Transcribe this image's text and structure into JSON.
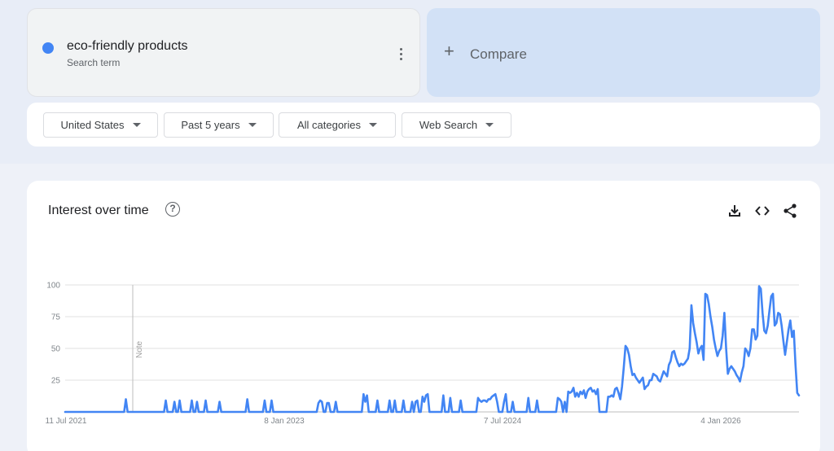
{
  "search_term": {
    "name": "eco-friendly products",
    "type_label": "Search term",
    "color": "#4285f4"
  },
  "compare": {
    "plus": "+",
    "label": "Compare"
  },
  "filters": [
    {
      "label": "United States"
    },
    {
      "label": "Past 5 years"
    },
    {
      "label": "All categories"
    },
    {
      "label": "Web Search"
    }
  ],
  "chart_card": {
    "title": "Interest over time",
    "help_icon": "?",
    "tools": [
      "download-icon",
      "embed-code-icon",
      "share-icon"
    ]
  },
  "chart_data": {
    "type": "line",
    "title": "Interest over time",
    "xlabel": "",
    "ylabel": "",
    "ylim": [
      0,
      100
    ],
    "y_ticks": [
      25,
      50,
      75,
      100
    ],
    "x_tick_labels": [
      "11 Jul 2021",
      "8 Jan 2023",
      "7 Jul 2024",
      "4 Jan 2026"
    ],
    "x_range": [
      "11 Jul 2021",
      "5 Jul 2026"
    ],
    "gridlines": true,
    "annotation": "Note",
    "series": [
      {
        "name": "eco-friendly products",
        "color": "#4285f4",
        "values": [
          0,
          0,
          0,
          0,
          0,
          0,
          0,
          0,
          0,
          0,
          0,
          0,
          0,
          0,
          0,
          0,
          0,
          0,
          0,
          0,
          0,
          0,
          0,
          0,
          0,
          0,
          0,
          0,
          0,
          0,
          0,
          0,
          0,
          0,
          0,
          10,
          0,
          0,
          0,
          0,
          0,
          0,
          0,
          0,
          0,
          0,
          0,
          0,
          0,
          0,
          0,
          0,
          0,
          0,
          0,
          0,
          0,
          0,
          9,
          0,
          0,
          0,
          0,
          8,
          0,
          0,
          9,
          0,
          0,
          0,
          0,
          0,
          0,
          9,
          0,
          0,
          8,
          0,
          0,
          0,
          0,
          9,
          0,
          0,
          0,
          0,
          0,
          0,
          0,
          8,
          0,
          0,
          0,
          0,
          0,
          0,
          0,
          0,
          0,
          0,
          0,
          0,
          0,
          0,
          0,
          10,
          0,
          0,
          0,
          0,
          0,
          0,
          0,
          0,
          0,
          9,
          0,
          0,
          0,
          9,
          0,
          0,
          0,
          0,
          0,
          0,
          0,
          0,
          0,
          0,
          0,
          0,
          0,
          0,
          0,
          0,
          0,
          0,
          0,
          0,
          0,
          0,
          0,
          0,
          0,
          0,
          7,
          9,
          8,
          0,
          0,
          7,
          7,
          0,
          0,
          0,
          8,
          0,
          0,
          0,
          0,
          0,
          0,
          0,
          0,
          0,
          0,
          0,
          0,
          0,
          0,
          0,
          14,
          8,
          13,
          0,
          0,
          0,
          0,
          0,
          9,
          0,
          0,
          0,
          0,
          0,
          0,
          9,
          0,
          0,
          9,
          0,
          0,
          0,
          0,
          9,
          0,
          0,
          0,
          0,
          8,
          0,
          8,
          9,
          0,
          0,
          12,
          8,
          13,
          14,
          0,
          0,
          0,
          0,
          0,
          0,
          0,
          0,
          13,
          0,
          0,
          0,
          11,
          0,
          0,
          0,
          0,
          0,
          9,
          0,
          0,
          0,
          0,
          0,
          0,
          0,
          0,
          0,
          11,
          9,
          8,
          9,
          9,
          8,
          10,
          10,
          12,
          13,
          14,
          8,
          0,
          0,
          0,
          8,
          14,
          0,
          0,
          0,
          8,
          0,
          0,
          0,
          0,
          0,
          0,
          0,
          0,
          11,
          0,
          0,
          0,
          0,
          9,
          0,
          0,
          0,
          0,
          0,
          0,
          0,
          0,
          0,
          0,
          0,
          11,
          10,
          8,
          0,
          8,
          0,
          16,
          15,
          16,
          19,
          12,
          15,
          12,
          16,
          14,
          17,
          11,
          16,
          18,
          19,
          16,
          17,
          14,
          18,
          0,
          0,
          0,
          0,
          0,
          12,
          12,
          13,
          12,
          18,
          19,
          15,
          10,
          20,
          35,
          52,
          50,
          45,
          36,
          29,
          30,
          27,
          25,
          23,
          25,
          27,
          18,
          20,
          21,
          25,
          25,
          30,
          29,
          28,
          25,
          24,
          28,
          32,
          30,
          28,
          37,
          40,
          47,
          48,
          43,
          39,
          36,
          38,
          37,
          38,
          40,
          42,
          50,
          84,
          70,
          62,
          55,
          46,
          50,
          52,
          41,
          93,
          92,
          85,
          75,
          67,
          57,
          50,
          44,
          48,
          50,
          60,
          78,
          50,
          30,
          34,
          36,
          34,
          32,
          29,
          27,
          24,
          31,
          36,
          50,
          48,
          44,
          50,
          65,
          65,
          57,
          60,
          99,
          97,
          78,
          64,
          62,
          68,
          80,
          91,
          93,
          68,
          70,
          78,
          77,
          68,
          56,
          45,
          55,
          65,
          72,
          59,
          64,
          37,
          15,
          13
        ]
      }
    ]
  }
}
